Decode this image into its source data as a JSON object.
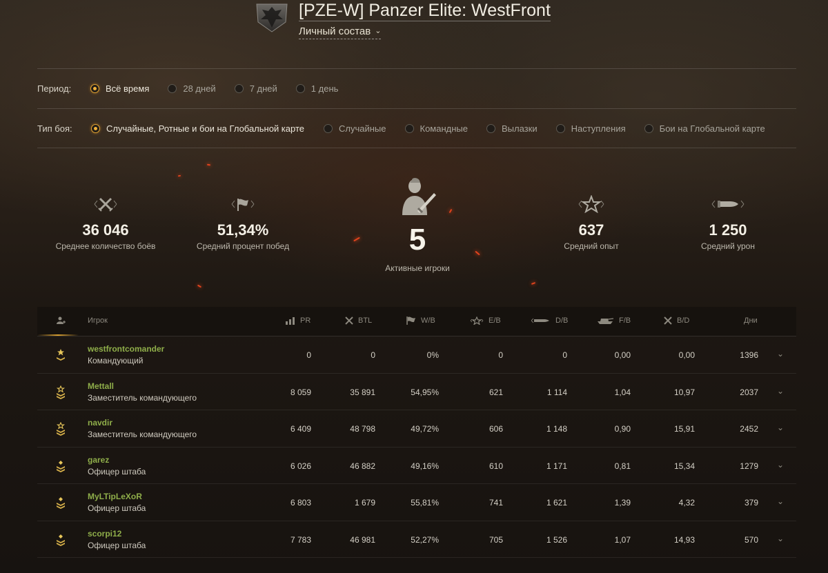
{
  "header": {
    "clan_title": "[PZE-W] Panzer Elite: WestFront",
    "section": "Личный состав"
  },
  "filters": {
    "period_label": "Период:",
    "period_options": [
      {
        "label": "Всё время",
        "selected": true
      },
      {
        "label": "28 дней",
        "selected": false
      },
      {
        "label": "7 дней",
        "selected": false
      },
      {
        "label": "1 день",
        "selected": false
      }
    ],
    "battle_type_label": "Тип боя:",
    "battle_type_options": [
      {
        "label": "Случайные, Ротные и бои на Глобальной карте",
        "selected": true
      },
      {
        "label": "Случайные",
        "selected": false
      },
      {
        "label": "Командные",
        "selected": false
      },
      {
        "label": "Вылазки",
        "selected": false
      },
      {
        "label": "Наступления",
        "selected": false
      },
      {
        "label": "Бои на Глобальной карте",
        "selected": false
      }
    ]
  },
  "stats": {
    "avg_battles": {
      "value": "36 046",
      "label": "Среднее количество боёв",
      "icon": "crossed-swords-icon"
    },
    "avg_winrate": {
      "value": "51,34%",
      "label": "Средний процент побед",
      "icon": "flag-icon"
    },
    "active_players": {
      "value": "5",
      "label": "Активные игроки",
      "icon": "soldier-icon"
    },
    "avg_xp": {
      "value": "637",
      "label": "Средний опыт",
      "icon": "star-icon"
    },
    "avg_damage": {
      "value": "1 250",
      "label": "Средний урон",
      "icon": "shell-icon"
    }
  },
  "table": {
    "columns": {
      "rank": "",
      "player": "Игрок",
      "pr": "PR",
      "btl": "BTL",
      "wb": "W/B",
      "eb": "E/B",
      "db": "D/B",
      "fb": "F/B",
      "bd": "B/D",
      "days": "Дни"
    },
    "rows": [
      {
        "name": "westfrontcomander",
        "role": "Командующий",
        "rank": "commander",
        "pr": "0",
        "btl": "0",
        "wb": "0%",
        "eb": "0",
        "db": "0",
        "fb": "0,00",
        "bd": "0,00",
        "days": "1396"
      },
      {
        "name": "Mettall",
        "role": "Заместитель командующего",
        "rank": "deputy",
        "pr": "8 059",
        "btl": "35 891",
        "wb": "54,95%",
        "eb": "621",
        "db": "1 114",
        "fb": "1,04",
        "bd": "10,97",
        "days": "2037"
      },
      {
        "name": "navdir",
        "role": "Заместитель командующего",
        "rank": "deputy",
        "pr": "6 409",
        "btl": "48 798",
        "wb": "49,72%",
        "eb": "606",
        "db": "1 148",
        "fb": "0,90",
        "bd": "15,91",
        "days": "2452"
      },
      {
        "name": "garez",
        "role": "Офицер штаба",
        "rank": "staff",
        "pr": "6 026",
        "btl": "46 882",
        "wb": "49,16%",
        "eb": "610",
        "db": "1 171",
        "fb": "0,81",
        "bd": "15,34",
        "days": "1279"
      },
      {
        "name": "MyLTipLeXoR",
        "role": "Офицер штаба",
        "rank": "staff",
        "pr": "6 803",
        "btl": "1 679",
        "wb": "55,81%",
        "eb": "741",
        "db": "1 621",
        "fb": "1,39",
        "bd": "4,32",
        "days": "379"
      },
      {
        "name": "scorpi12",
        "role": "Офицер штаба",
        "rank": "staff",
        "pr": "7 783",
        "btl": "46 981",
        "wb": "52,27%",
        "eb": "705",
        "db": "1 526",
        "fb": "1,07",
        "bd": "14,93",
        "days": "570"
      }
    ]
  },
  "colors": {
    "accent": "#f2b23a",
    "player_name": "#8fae4a",
    "spark": "#e0431d"
  }
}
